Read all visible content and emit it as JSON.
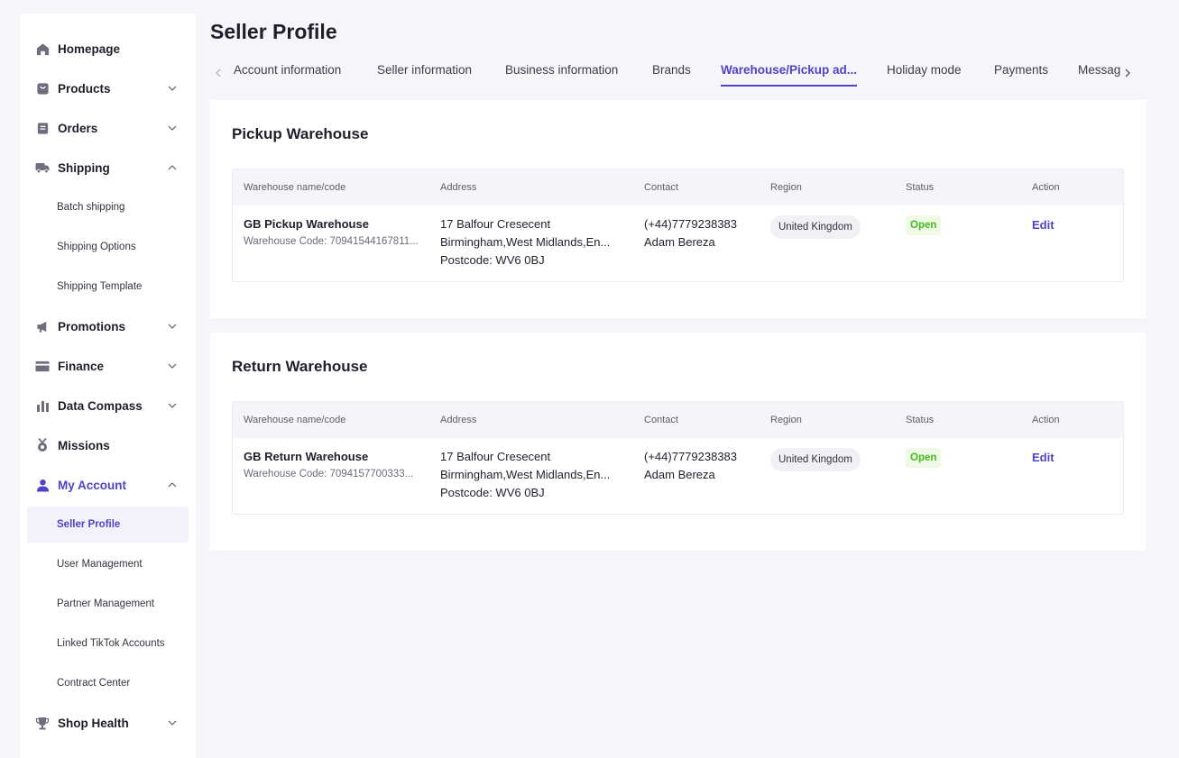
{
  "page": {
    "title": "Seller Profile"
  },
  "sidebar": {
    "items": [
      {
        "label": "Homepage",
        "icon": "home-icon"
      },
      {
        "label": "Products",
        "icon": "box-icon"
      },
      {
        "label": "Orders",
        "icon": "document-icon"
      },
      {
        "label": "Shipping",
        "icon": "truck-icon"
      },
      {
        "label": "Promotions",
        "icon": "megaphone-icon"
      },
      {
        "label": "Finance",
        "icon": "card-icon"
      },
      {
        "label": "Data Compass",
        "icon": "chart-icon"
      },
      {
        "label": "Missions",
        "icon": "medal-icon"
      },
      {
        "label": "My Account",
        "icon": "user-icon"
      },
      {
        "label": "Shop Health",
        "icon": "trophy-icon"
      }
    ],
    "shipping_sub": [
      "Batch shipping",
      "Shipping Options",
      "Shipping Template"
    ],
    "account_sub": [
      "Seller Profile",
      "User Management",
      "Partner Management",
      "Linked TikTok Accounts",
      "Contract Center"
    ]
  },
  "tabs": [
    "Account information",
    "Seller information",
    "Business information",
    "Brands",
    "Warehouse/Pickup ad...",
    "Holiday mode",
    "Payments",
    "Messag"
  ],
  "columns": [
    "Warehouse name/code",
    "Address",
    "Contact",
    "Region",
    "Status",
    "Action"
  ],
  "pickup": {
    "title": "Pickup Warehouse",
    "row": {
      "name": "GB Pickup Warehouse",
      "code": "Warehouse Code: 70941544167811...",
      "address1": "17 Balfour Cresecent",
      "address2": "Birmingham,West Midlands,En...",
      "address3": "Postcode: WV6 0BJ",
      "phone": "(+44)7779238383",
      "contact_name": "Adam Bereza",
      "region": "United Kingdom",
      "status": "Open",
      "action": "Edit"
    }
  },
  "return": {
    "title": "Return Warehouse",
    "row": {
      "name": "GB Return Warehouse",
      "code": "Warehouse Code: 7094157700333...",
      "address1": "17 Balfour Cresecent",
      "address2": "Birmingham,West Midlands,En...",
      "address3": "Postcode: WV6 0BJ",
      "phone": "(+44)7779238383",
      "contact_name": "Adam Bereza",
      "region": "United Kingdom",
      "status": "Open",
      "action": "Edit"
    }
  },
  "colors": {
    "accent": "#4f43c7",
    "status_open": "#47b81f",
    "background": "#f5f5fa"
  }
}
